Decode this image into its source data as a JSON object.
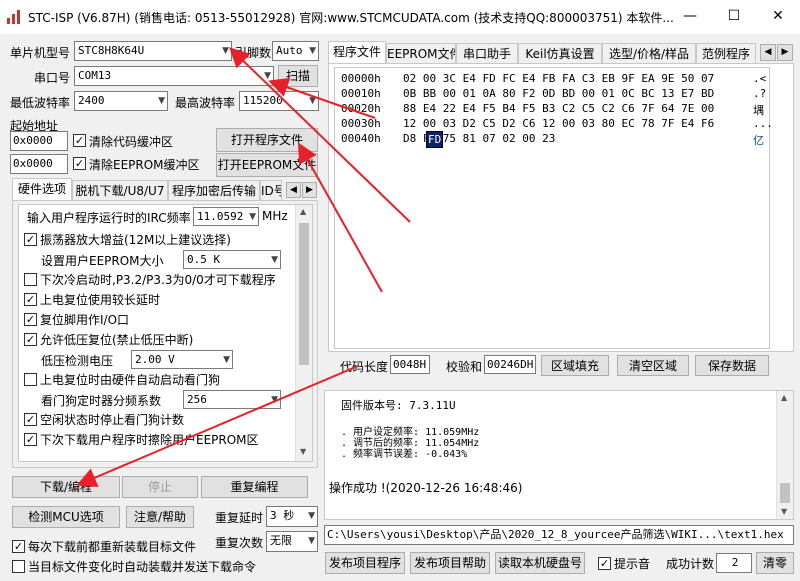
{
  "title": "STC-ISP (V6.87H) (销售电话: 0513-55012928) 官网:www.STCMCUDATA.com  (技术支持QQ:800003751) 本软件...",
  "window": {
    "minimize": "—",
    "maximize": "☐",
    "close": "✕"
  },
  "left": {
    "mcu_label": "单片机型号",
    "mcu_value": "STC8H8K64U",
    "pin_label": "引脚数",
    "pin_value": "Auto",
    "port_label": "串口号",
    "port_value": "COM13",
    "scan_label": "扫描",
    "min_baud_label": "最低波特率",
    "min_baud_value": "2400",
    "max_baud_label": "最高波特率",
    "max_baud_value": "115200",
    "start_addr_label": "起始地址",
    "addr1": "0x0000",
    "clear_code_label": "清除代码缓冲区",
    "open_prog_label": "打开程序文件",
    "addr2": "0x0000",
    "clear_eeprom_label": "清除EEPROM缓冲区",
    "open_eeprom_label": "打开EEPROM文件"
  },
  "hw_tabs": [
    "硬件选项",
    "脱机下载/U8/U7",
    "程序加密后传输",
    "ID号"
  ],
  "hw_options": {
    "irc_label": "输入用户程序运行时的IRC频率",
    "irc_value": "11.0592",
    "irc_unit": "MHz",
    "osc_gain": "振荡器放大增益(12M以上建议选择)",
    "eeprom_size_label": "设置用户EEPROM大小",
    "eeprom_size_value": "0.5 K",
    "cold_start": "下次冷启动时,P3.2/P3.3为0/0才可下载程序",
    "por_delay": "上电复位使用较长延时",
    "reset_pin": "复位脚用作I/O口",
    "lvr": "允许低压复位(禁止低压中断)",
    "lvd_label": "低压检测电压",
    "lvd_value": "2.00 V",
    "wdt_hw": "上电复位时由硬件自动启动看门狗",
    "wdt_div_label": "看门狗定时器分频系数",
    "wdt_div_value": "256",
    "wdt_idle": "空闲状态时停止看门狗计数",
    "erase_eeprom": "下次下载用户程序时擦除用户EEPROM区"
  },
  "bottom_left": {
    "download": "下载/编程",
    "stop": "停止",
    "reprog": "重复编程",
    "check_mcu": "检测MCU选项",
    "help": "注意/帮助",
    "retry_delay_label": "重复延时",
    "retry_delay_value": "3 秒",
    "retry_count_label": "重复次数",
    "retry_count_value": "无限",
    "reload_each": "每次下载前都重新装载目标文件",
    "auto_send": "当目标文件变化时自动装载并发送下载命令"
  },
  "right_tabs": [
    "程序文件",
    "EEPROM文件",
    "串口助手",
    "Keil仿真设置",
    "选型/价格/样品",
    "范例程序"
  ],
  "hex_rows": [
    {
      "addr": "00000h",
      "bytes": "02 00 3C E4 FD FC E4 FB FA C3 EB 9F EA 9E 50 07",
      "ascii": ".<"
    },
    {
      "addr": "00010h",
      "bytes": "0B BB 00 01 0A 80 F2 0D BD 00 01 0C BC 13 E7 BD",
      "ascii": ".?"
    },
    {
      "addr": "00020h",
      "bytes": "88 E4 22 E4 F5 B4 F5 B3 C2 C5 C2 C6 7F 64 7E 00",
      "ascii": "堣"
    },
    {
      "addr": "00030h",
      "bytes": "12 00 03 D2 C5 D2 C6 12 00 03 80 EC 78 7F E4 F6",
      "ascii": "..."
    },
    {
      "addr": "00040h",
      "bytes": "D8 FD 75 81 07 02 00 23",
      "ascii": "亿"
    }
  ],
  "hex_cursor": "FD",
  "code_len_label": "代码长度",
  "code_len_value": "0048H",
  "checksum_label": "校验和",
  "checksum_value": "00246DH",
  "fill_btn": "区域填充",
  "clear_btn": "清空区域",
  "save_btn": "保存数据",
  "log": {
    "fw": "固件版本号: 7.3.11U",
    "set_freq": ". 用户设定频率: 11.059MHz",
    "adj_freq": ". 调节后的频率: 11.054MHz",
    "freq_err": ". 频率调节误差: -0.043%",
    "success": "操作成功 !(2020-12-26 16:48:46)"
  },
  "path": "C:\\Users\\yousi\\Desktop\\产品\\2020_12_8_yourcee产品筛选\\WIKI...\\text1.hex",
  "footer": {
    "publish_prog": "发布项目程序",
    "publish_help": "发布项目帮助",
    "read_disk": "读取本机硬盘号",
    "sound_label": "提示音",
    "count_label": "成功计数",
    "count_value": "2",
    "clear": "清零"
  },
  "colors": {
    "arrow": "#e8202a",
    "selection": "#0a246a"
  }
}
